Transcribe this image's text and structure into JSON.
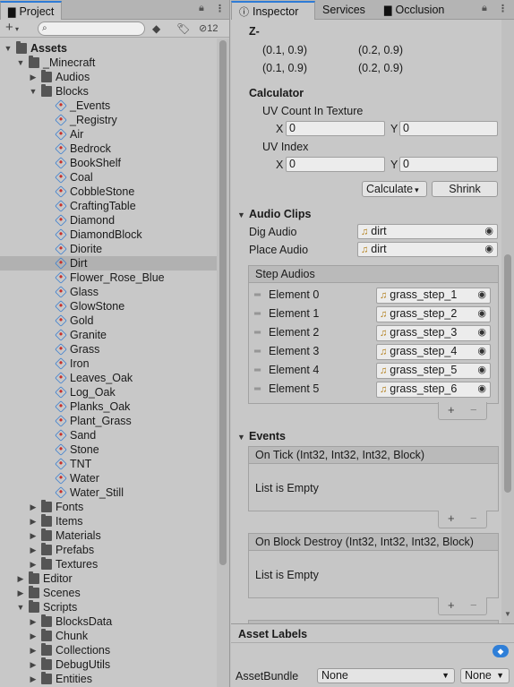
{
  "project_panel": {
    "tab_label": "Project",
    "lock_icon": "lock-icon",
    "menu_icon": "kebab-menu-icon",
    "toolbar": {
      "add_label": "+",
      "search_placeholder": "",
      "hidden_count": "12"
    },
    "tree": [
      {
        "label": "Assets",
        "level": 0,
        "expanded": true,
        "type": "folder",
        "bold": true
      },
      {
        "label": "_Minecraft",
        "level": 1,
        "expanded": true,
        "type": "folder"
      },
      {
        "label": "Audios",
        "level": 2,
        "expanded": false,
        "type": "folder"
      },
      {
        "label": "Blocks",
        "level": 2,
        "expanded": true,
        "type": "folder"
      },
      {
        "label": "_Events",
        "level": 3,
        "type": "asset"
      },
      {
        "label": "_Registry",
        "level": 3,
        "type": "asset"
      },
      {
        "label": "Air",
        "level": 3,
        "type": "asset"
      },
      {
        "label": "Bedrock",
        "level": 3,
        "type": "asset"
      },
      {
        "label": "BookShelf",
        "level": 3,
        "type": "asset"
      },
      {
        "label": "Coal",
        "level": 3,
        "type": "asset"
      },
      {
        "label": "CobbleStone",
        "level": 3,
        "type": "asset"
      },
      {
        "label": "CraftingTable",
        "level": 3,
        "type": "asset"
      },
      {
        "label": "Diamond",
        "level": 3,
        "type": "asset"
      },
      {
        "label": "DiamondBlock",
        "level": 3,
        "type": "asset"
      },
      {
        "label": "Diorite",
        "level": 3,
        "type": "asset"
      },
      {
        "label": "Dirt",
        "level": 3,
        "type": "asset",
        "selected": true
      },
      {
        "label": "Flower_Rose_Blue",
        "level": 3,
        "type": "asset"
      },
      {
        "label": "Glass",
        "level": 3,
        "type": "asset"
      },
      {
        "label": "GlowStone",
        "level": 3,
        "type": "asset"
      },
      {
        "label": "Gold",
        "level": 3,
        "type": "asset"
      },
      {
        "label": "Granite",
        "level": 3,
        "type": "asset"
      },
      {
        "label": "Grass",
        "level": 3,
        "type": "asset"
      },
      {
        "label": "Iron",
        "level": 3,
        "type": "asset"
      },
      {
        "label": "Leaves_Oak",
        "level": 3,
        "type": "asset"
      },
      {
        "label": "Log_Oak",
        "level": 3,
        "type": "asset"
      },
      {
        "label": "Planks_Oak",
        "level": 3,
        "type": "asset"
      },
      {
        "label": "Plant_Grass",
        "level": 3,
        "type": "asset"
      },
      {
        "label": "Sand",
        "level": 3,
        "type": "asset"
      },
      {
        "label": "Stone",
        "level": 3,
        "type": "asset"
      },
      {
        "label": "TNT",
        "level": 3,
        "type": "asset"
      },
      {
        "label": "Water",
        "level": 3,
        "type": "asset"
      },
      {
        "label": "Water_Still",
        "level": 3,
        "type": "asset"
      },
      {
        "label": "Fonts",
        "level": 2,
        "expanded": false,
        "type": "folder"
      },
      {
        "label": "Items",
        "level": 2,
        "expanded": false,
        "type": "folder"
      },
      {
        "label": "Materials",
        "level": 2,
        "expanded": false,
        "type": "folder"
      },
      {
        "label": "Prefabs",
        "level": 2,
        "expanded": false,
        "type": "folder"
      },
      {
        "label": "Textures",
        "level": 2,
        "expanded": false,
        "type": "folder"
      },
      {
        "label": "Editor",
        "level": 1,
        "expanded": false,
        "type": "folder"
      },
      {
        "label": "Scenes",
        "level": 1,
        "expanded": false,
        "type": "folder"
      },
      {
        "label": "Scripts",
        "level": 1,
        "expanded": true,
        "type": "folder"
      },
      {
        "label": "BlocksData",
        "level": 2,
        "expanded": false,
        "type": "folder"
      },
      {
        "label": "Chunk",
        "level": 2,
        "expanded": false,
        "type": "folder"
      },
      {
        "label": "Collections",
        "level": 2,
        "expanded": false,
        "type": "folder"
      },
      {
        "label": "DebugUtils",
        "level": 2,
        "expanded": false,
        "type": "folder"
      },
      {
        "label": "Entities",
        "level": 2,
        "expanded": false,
        "type": "folder"
      }
    ]
  },
  "inspector_panel": {
    "tabs": [
      {
        "label": "Inspector",
        "active": true,
        "icon": "info-icon"
      },
      {
        "label": "Services",
        "active": false
      },
      {
        "label": "Occlusion",
        "active": false,
        "icon": "folder-icon"
      }
    ],
    "z_minus": {
      "label": "Z-",
      "values": [
        "(0.1, 0.9)",
        "(0.2, 0.9)",
        "(0.1, 0.9)",
        "(0.2, 0.9)"
      ]
    },
    "calculator": {
      "header": "Calculator",
      "uv_count_label": "UV Count In Texture",
      "uv_count_x_label": "X",
      "uv_count_x": "0",
      "uv_count_y_label": "Y",
      "uv_count_y": "0",
      "uv_index_label": "UV Index",
      "uv_index_x_label": "X",
      "uv_index_x": "0",
      "uv_index_y_label": "Y",
      "uv_index_y": "0",
      "calculate_label": "Calculate",
      "shrink_label": "Shrink"
    },
    "audio_clips": {
      "header": "Audio Clips",
      "dig_label": "Dig Audio",
      "dig_value": "dirt",
      "place_label": "Place Audio",
      "place_value": "dirt",
      "step_header": "Step Audios",
      "elements": [
        {
          "label": "Element 0",
          "value": "grass_step_1"
        },
        {
          "label": "Element 1",
          "value": "grass_step_2"
        },
        {
          "label": "Element 2",
          "value": "grass_step_3"
        },
        {
          "label": "Element 3",
          "value": "grass_step_4"
        },
        {
          "label": "Element 4",
          "value": "grass_step_5"
        },
        {
          "label": "Element 5",
          "value": "grass_step_6"
        }
      ],
      "add_label": "+",
      "remove_label": "−"
    },
    "events": {
      "header": "Events",
      "on_tick": {
        "header": "On Tick (Int32, Int32, Int32, Block)",
        "empty": "List is Empty"
      },
      "on_destroy": {
        "header": "On Block Destroy (Int32, Int32, Int32, Block)",
        "empty": "List is Empty"
      },
      "add_label": "+",
      "remove_label": "−"
    },
    "asset_labels": {
      "header": "Asset Labels",
      "asset_bundle_label": "AssetBundle",
      "asset_bundle_value": "None",
      "variant_value": "None"
    }
  },
  "colors": {
    "accent": "#2e7bd6",
    "selection": "#b1b1b1",
    "panel": "#c8c8c8"
  }
}
